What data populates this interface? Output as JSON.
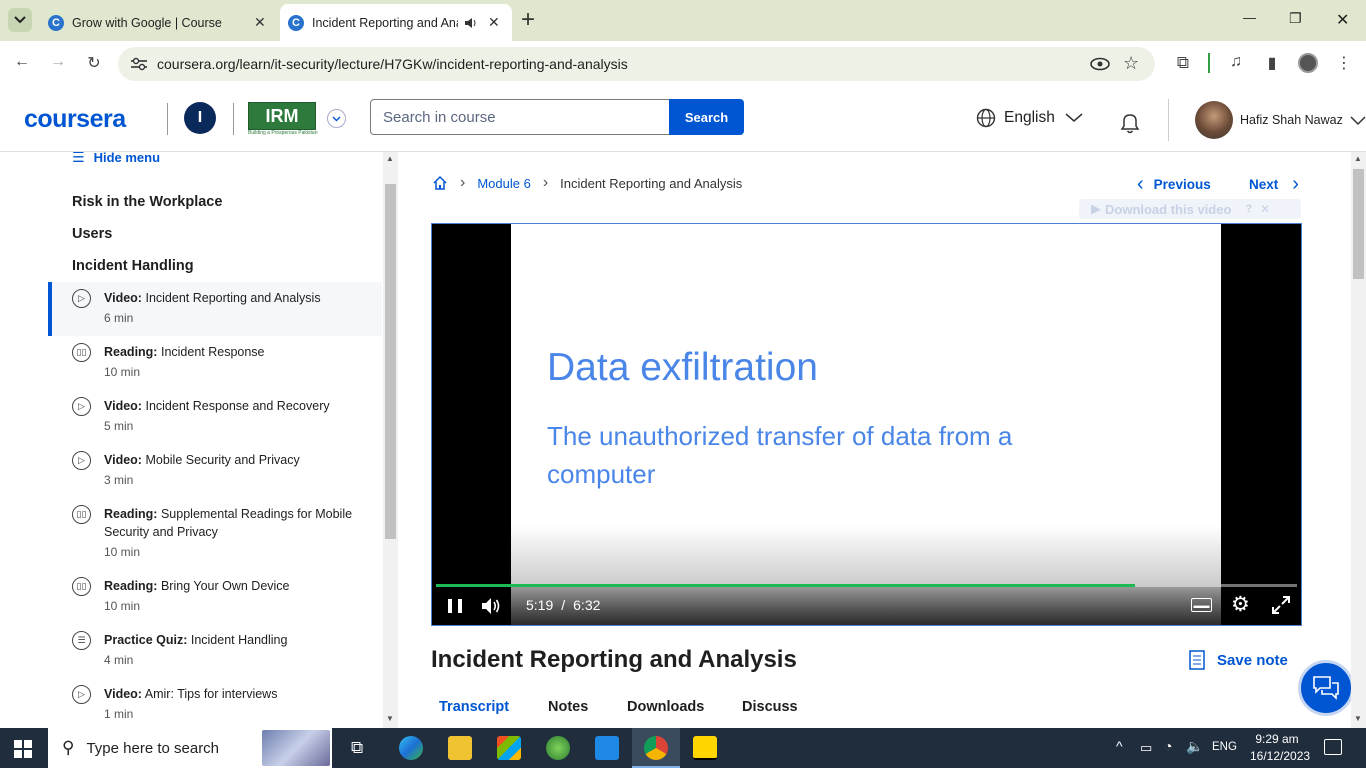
{
  "browser": {
    "tabs": [
      {
        "title": "Grow with Google | Coursera",
        "active": false
      },
      {
        "title": "Incident Reporting and Ana",
        "active": true
      }
    ],
    "new_tab": "+",
    "url": "coursera.org/learn/it-security/lecture/H7GKw/incident-reporting-and-analysis",
    "window_controls": {
      "minimize": "—",
      "maximize": "❐",
      "close": "✕"
    }
  },
  "header": {
    "logo": "coursera",
    "user_initial": "I",
    "partner_logo": "IRM",
    "partner_tagline": "Building a Prosperous Pakistan",
    "search_placeholder": "Search in course",
    "search_button": "Search",
    "language": "English",
    "user_name": "Hafiz Shah Nawaz"
  },
  "sidebar": {
    "hide_menu": "Hide menu",
    "sections": [
      "Risk in the Workplace",
      "Users",
      "Incident Handling"
    ],
    "items": [
      {
        "type": "Video:",
        "title": "Incident Reporting and Analysis",
        "duration": "6 min",
        "icon": "play-icon",
        "active": true
      },
      {
        "type": "Reading:",
        "title": "Incident Response",
        "duration": "10 min",
        "icon": "book-icon"
      },
      {
        "type": "Video:",
        "title": "Incident Response and Recovery",
        "duration": "5 min",
        "icon": "play-icon"
      },
      {
        "type": "Video:",
        "title": "Mobile Security and Privacy",
        "duration": "3 min",
        "icon": "play-icon"
      },
      {
        "type": "Reading:",
        "title": "Supplemental Readings for Mobile Security and Privacy",
        "duration": "10 min",
        "icon": "book-icon"
      },
      {
        "type": "Reading:",
        "title": "Bring Your Own Device",
        "duration": "10 min",
        "icon": "book-icon"
      },
      {
        "type": "Practice Quiz:",
        "title": "Incident Handling",
        "duration": "4 min",
        "icon": "quiz-icon"
      },
      {
        "type": "Video:",
        "title": "Amir: Tips for interviews",
        "duration": "1 min",
        "icon": "play-icon"
      }
    ]
  },
  "main": {
    "breadcrumb": {
      "module": "Module 6",
      "current": "Incident Reporting and Analysis"
    },
    "prev": "Previous",
    "next": "Next",
    "download_video": "Download this video",
    "slide_title": "Data exfiltration",
    "slide_body": "The unauthorized transfer of data from a computer",
    "time_current": "5:19",
    "time_separator": "/",
    "time_total": "6:32",
    "progress": 0.812,
    "lecture_title": "Incident Reporting and Analysis",
    "save_note": "Save note",
    "tabs": [
      "Transcript",
      "Notes",
      "Downloads",
      "Discuss"
    ]
  },
  "taskbar": {
    "search_placeholder": "Type here to search",
    "lang": "ENG",
    "time": "9:29 am",
    "date": "16/12/2023"
  },
  "colors": {
    "brand": "#0056d2",
    "tabstrip": "#dfe8cf",
    "taskbar": "#1f2d3d",
    "progress": "#1db954"
  }
}
